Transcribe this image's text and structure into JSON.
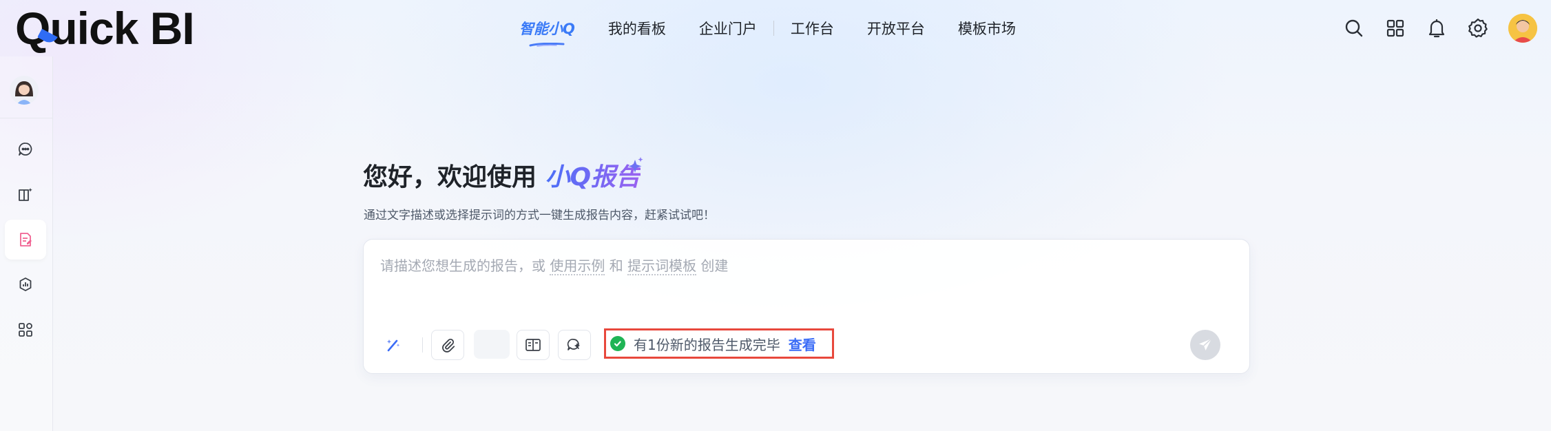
{
  "header": {
    "logo_text_main": "uick BI",
    "logo_text_q": "Q",
    "nav": [
      {
        "label": "智能小Q",
        "active": true
      },
      {
        "label": "我的看板",
        "active": false
      },
      {
        "label": "企业门户",
        "active": false
      },
      {
        "label": "工作台",
        "active": false
      },
      {
        "label": "开放平台",
        "active": false
      },
      {
        "label": "模板市场",
        "active": false
      }
    ],
    "right_icons": [
      "search-icon",
      "apps-grid-icon",
      "bell-icon",
      "gear-icon",
      "user-avatar"
    ]
  },
  "sidebar": {
    "items": [
      {
        "icon": "chat-icon",
        "active": false
      },
      {
        "icon": "book-sparkle-icon",
        "active": false
      },
      {
        "icon": "report-icon",
        "active": true
      },
      {
        "icon": "analysis-icon",
        "active": false
      },
      {
        "icon": "grid-apps-icon",
        "active": false
      }
    ]
  },
  "main": {
    "greeting_prefix": "您好，欢迎使用 ",
    "greeting_brand": "小Q报告",
    "subtitle": "通过文字描述或选择提示词的方式一键生成报告内容，赶紧试试吧！",
    "composer": {
      "placeholder_a": "请描述您想生成的报告，或 ",
      "placeholder_link1": "使用示例",
      "placeholder_b": " 和 ",
      "placeholder_link2": "提示词模板",
      "placeholder_c": " 创建",
      "notice_text": "有1份新的报告生成完毕",
      "notice_action": "查看"
    }
  },
  "colors": {
    "accent": "#3b7bf7",
    "brand_gradient_start": "#4a6ff7",
    "brand_gradient_end": "#9a62f0",
    "success": "#1fb455",
    "highlight_border": "#e8483c",
    "active_sidebar_icon": "#f06292"
  }
}
